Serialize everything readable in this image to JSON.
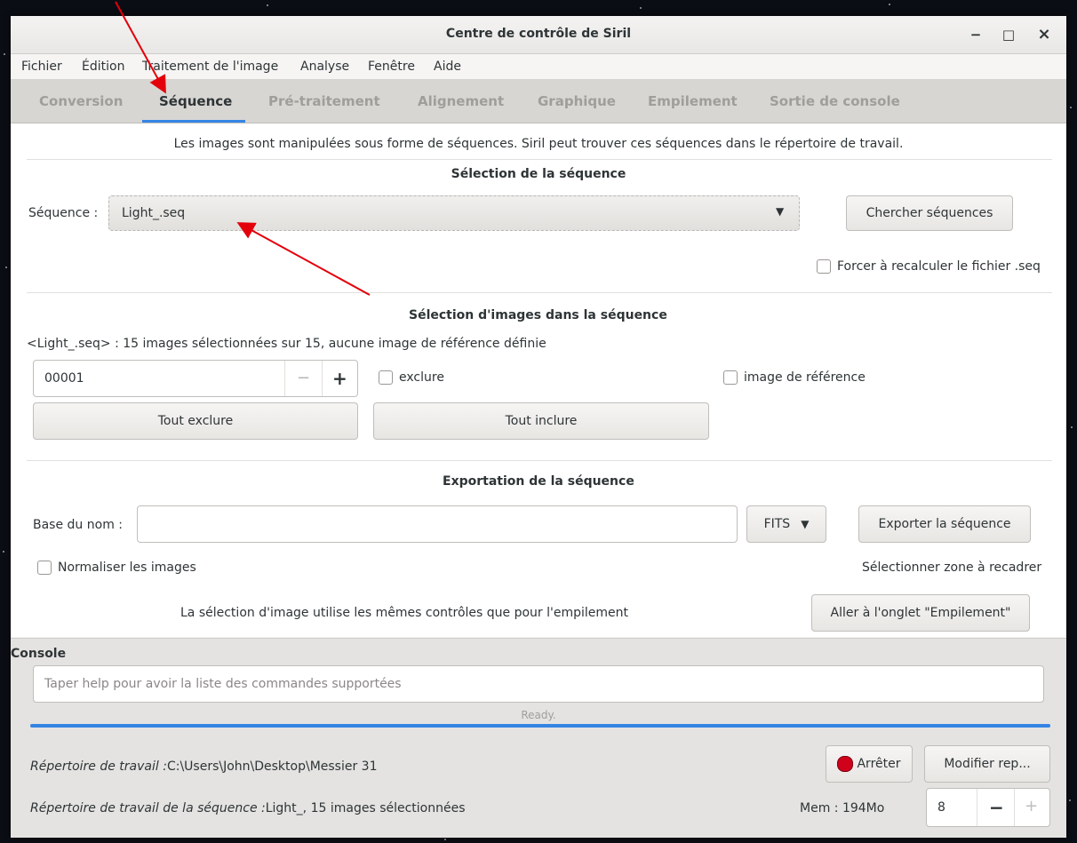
{
  "window": {
    "title": "Centre de contrôle de Siril",
    "minimize": "−",
    "maximize": "□",
    "close": "×"
  },
  "menu": [
    "Fichier",
    "Édition",
    "Traitement de l'image",
    "Analyse",
    "Fenêtre",
    "Aide"
  ],
  "tabs": [
    "Conversion",
    "Séquence",
    "Pré-traitement",
    "Alignement",
    "Graphique",
    "Empilement",
    "Sortie de console"
  ],
  "active_tab": "Séquence",
  "intro_text": "Les images sont manipulées sous forme de séquences. Siril peut trouver ces séquences dans le répertoire de travail.",
  "sequence_selection": {
    "heading": "Sélection de la séquence",
    "label": "Séquence :",
    "selected": "Light_.seq",
    "search_button": "Chercher séquences",
    "force_recalc_label": "Forcer à recalculer le fichier .seq"
  },
  "image_selection": {
    "heading": "Sélection d'images dans la séquence",
    "status": "<Light_.seq> : 15 images sélectionnées sur 15, aucune image de référence définie",
    "frame_value": "00001",
    "minus": "−",
    "plus": "+",
    "exclude_label": "exclure",
    "reference_label": "image de référence",
    "exclude_all_button": "Tout exclure",
    "include_all_button": "Tout inclure"
  },
  "export": {
    "heading": "Exportation de la séquence",
    "basename_label": "Base du nom :",
    "basename_value": "",
    "format": "FITS",
    "export_button": "Exporter la séquence",
    "normalize_label": "Normaliser les images",
    "crop_text": "Sélectionner zone à recadrer",
    "note": "La sélection d'image utilise les mêmes contrôles que pour l'empilement",
    "goto_stack_button": "Aller à l'onglet \"Empilement\""
  },
  "console": {
    "label": "Console",
    "placeholder": "Taper help pour avoir la liste des commandes supportées",
    "progress_text": "Ready.",
    "progress": 1.0,
    "workdir_label": "Répertoire de travail :",
    "workdir_value": "C:\\Users\\John\\Desktop\\Messier 31",
    "seqdir_label": "Répertoire de travail de la séquence :",
    "seqdir_value": "Light_, 15 images sélectionnées",
    "stop_button": "Arrêter",
    "change_dir_button": "Modifier rep...",
    "mem_text": "Mem : 194Mo",
    "threads_value": "8",
    "minus": "−",
    "plus": "+"
  },
  "colors": {
    "accent": "#3584e4",
    "annotation_arrow": "#e3000b",
    "stop_red": "#d0021b"
  }
}
